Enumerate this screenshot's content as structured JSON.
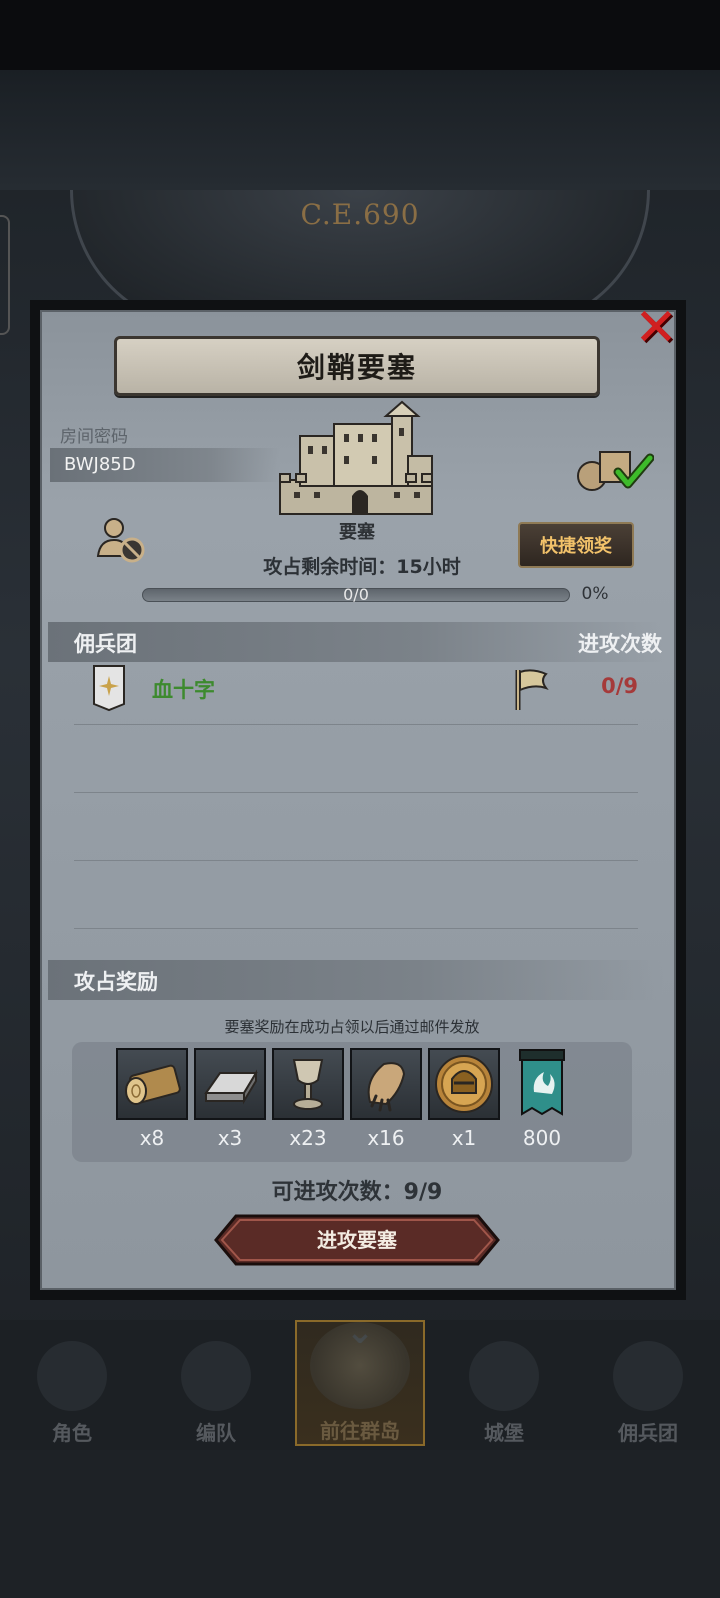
{
  "background": {
    "era_label": "C.E.690"
  },
  "dialog": {
    "title": "剑鞘要塞",
    "room": {
      "label": "房间密码",
      "code": "BWJ85D"
    },
    "building_type": "要塞",
    "quick_claim_label": "快捷领奖",
    "remaining_time": "攻占剩余时间：15小时",
    "progress": {
      "text": "0/0",
      "percent_text": "0%",
      "fraction": 0
    },
    "mercenary_section": {
      "left_title": "佣兵团",
      "right_title": "进攻次数"
    },
    "guilds": [
      {
        "name": "血十字",
        "attacks": "0/9"
      }
    ],
    "reward_section_title": "攻占奖励",
    "reward_note": "要塞奖励在成功占领以后通过邮件发放",
    "rewards": [
      {
        "icon": "wood-log-icon",
        "qty": "x8"
      },
      {
        "icon": "iron-ingot-icon",
        "qty": "x3"
      },
      {
        "icon": "goblet-icon",
        "qty": "x23"
      },
      {
        "icon": "fur-pelt-icon",
        "qty": "x16"
      },
      {
        "icon": "knight-helmet-coin-icon",
        "qty": "x1"
      },
      {
        "icon": "teal-banner-icon",
        "qty": "800"
      }
    ],
    "attack_count": "可进攻次数：9/9",
    "attack_button_label": "进攻要塞"
  },
  "bottom_nav": [
    {
      "label": "角色",
      "active": false
    },
    {
      "label": "编队",
      "active": false
    },
    {
      "label": "前往群岛",
      "active": true
    },
    {
      "label": "城堡",
      "active": false
    },
    {
      "label": "佣兵团",
      "active": false
    }
  ],
  "colors": {
    "guild_name": "#3d8a2e",
    "attack_count_red": "#a53a3a",
    "quick_btn_text": "#f2c26a",
    "close_red": "#d02020"
  }
}
